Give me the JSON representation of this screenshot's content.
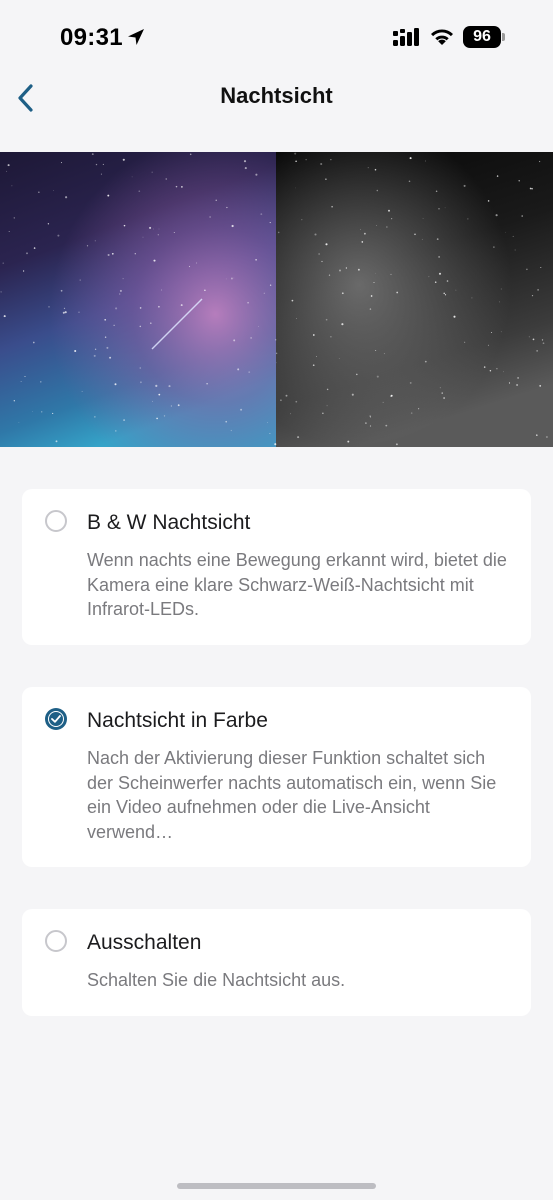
{
  "status_bar": {
    "time": "09:31",
    "battery": "96",
    "icons": [
      "location-arrow-icon",
      "cellular-signal-icon",
      "wifi-icon",
      "battery-icon"
    ]
  },
  "nav": {
    "title": "Nachtsicht",
    "back_icon": "chevron-left-icon"
  },
  "hero": {
    "left": "color night sky with milky way",
    "right": "black and white night sky"
  },
  "options": [
    {
      "title": "B & W Nachtsicht",
      "description": "Wenn nachts eine Bewegung erkannt wird, bietet die Kamera eine klare Schwarz-Weiß-Nachtsicht mit Infrarot-LEDs.",
      "selected": false
    },
    {
      "title": "Nachtsicht in Farbe",
      "description": "Nach der Aktivierung dieser Funktion schaltet sich der Scheinwerfer nachts automatisch ein, wenn Sie ein Video aufnehmen oder die Live-Ansicht verwend…",
      "selected": true
    },
    {
      "title": "Ausschalten",
      "description": "Schalten Sie die Nachtsicht aus.",
      "selected": false
    }
  ],
  "colors": {
    "accent": "#1e5f86",
    "background": "#f5f5f7",
    "card": "#ffffff"
  }
}
